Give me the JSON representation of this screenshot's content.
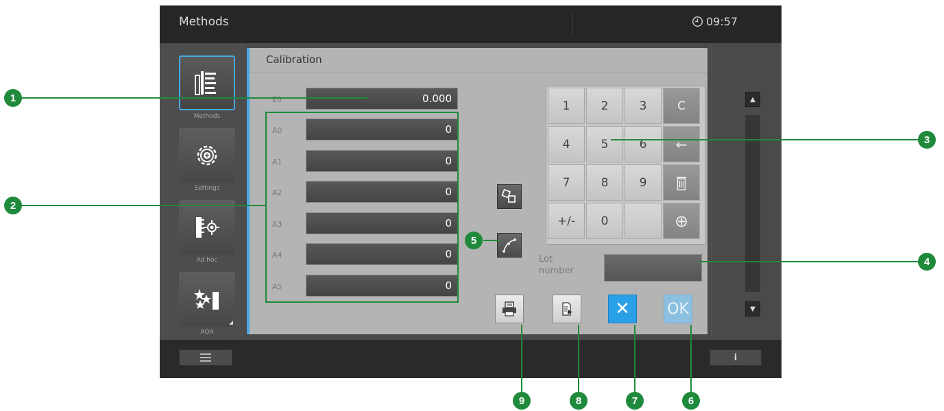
{
  "topbar": {
    "title": "Methods",
    "time": "09:57",
    "clock_icon": "clock-icon"
  },
  "sidebar": {
    "items": [
      {
        "label": "Methods",
        "icon": "methods-list-icon",
        "active": true
      },
      {
        "label": "Settings",
        "icon": "gear-icon",
        "active": false
      },
      {
        "label": "Ad hoc",
        "icon": "adhoc-measure-icon",
        "active": false
      },
      {
        "label": "AQA",
        "icon": "stars-aqa-icon",
        "active": false
      }
    ]
  },
  "panel": {
    "title": "Calibration",
    "fields": [
      {
        "label": "E0",
        "value": "0.000"
      },
      {
        "label": "A0",
        "value": "0"
      },
      {
        "label": "A1",
        "value": "0"
      },
      {
        "label": "A2",
        "value": "0"
      },
      {
        "label": "A3",
        "value": "0"
      },
      {
        "label": "A4",
        "value": "0"
      },
      {
        "label": "A5",
        "value": "0"
      }
    ],
    "keypad": {
      "rows": [
        [
          "1",
          "2",
          "3",
          "C"
        ],
        [
          "4",
          "5",
          "6",
          "←"
        ],
        [
          "7",
          "8",
          "9",
          "trash"
        ],
        [
          "+/-",
          "0",
          "",
          "⊕"
        ]
      ]
    },
    "lot_label_line1": "Lot",
    "lot_label_line2": "number",
    "lot_value": "",
    "tools": [
      "copy-coefficients-icon",
      "calibration-curve-icon"
    ],
    "actions": {
      "print_icon": "printer-icon",
      "export_icon": "export-document-icon",
      "cancel_label": "✕",
      "ok_label": "OK"
    }
  },
  "bottombar": {
    "menu_icon": "hamburger-menu-icon",
    "info_label": "i"
  },
  "callouts": [
    "1",
    "2",
    "3",
    "4",
    "5",
    "6",
    "7",
    "8",
    "9"
  ],
  "colors": {
    "callout": "#1f8a3c",
    "accent": "#4aa8e8",
    "cancel": "#2aa0e8",
    "ok": "#8cc0e0"
  }
}
